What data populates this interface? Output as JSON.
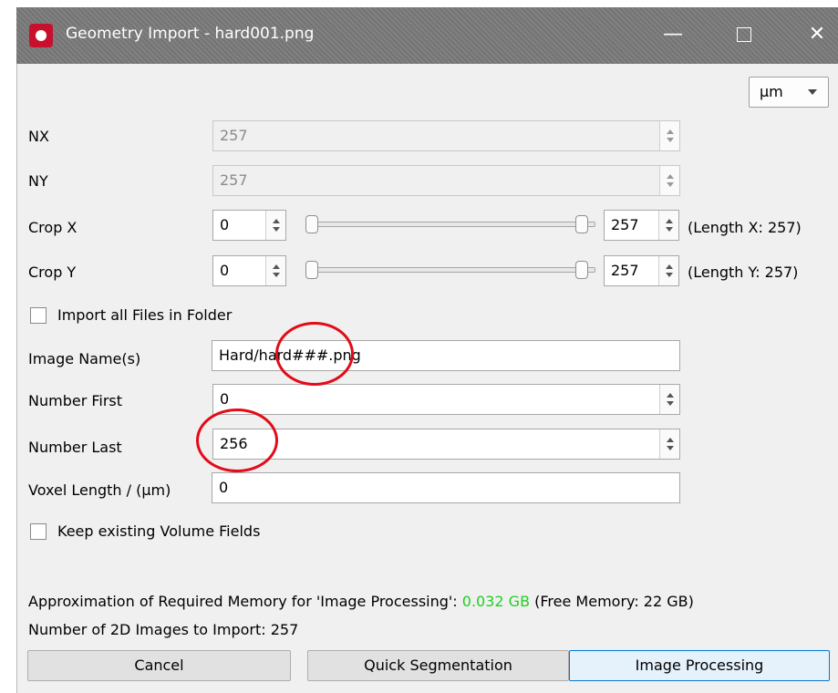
{
  "window": {
    "title": "Geometry Import - hard001.png",
    "app_icon": "app-logo-icon",
    "controls": [
      "minimize-icon",
      "maximize-icon",
      "close-icon"
    ],
    "minimize_glyph": "—",
    "close_glyph": "✕"
  },
  "unit_select": {
    "value": "µm"
  },
  "fields": {
    "nx": {
      "label": "NX",
      "value": "257"
    },
    "ny": {
      "label": "NY",
      "value": "257"
    },
    "crop_x": {
      "label": "Crop X",
      "min": "0",
      "max": "257",
      "length": "(Length X: 257)"
    },
    "crop_y": {
      "label": "Crop Y",
      "min": "0",
      "max": "257",
      "length": "(Length Y: 257)"
    },
    "image_names": {
      "label": "Image Name(s)",
      "value": "Hard/hard###.png"
    },
    "number_first": {
      "label": "Number First",
      "value": "0"
    },
    "number_last": {
      "label": "Number Last",
      "value": "256"
    },
    "voxel_length": {
      "label": "Voxel Length / (µm)",
      "value": "0"
    }
  },
  "checkboxes": {
    "import_all": {
      "label": "Import all Files in Folder",
      "checked": false
    },
    "keep_fields": {
      "label": "Keep existing Volume Fields",
      "checked": false
    }
  },
  "memory": {
    "prefix": "Approximation of Required Memory for 'Image Processing': ",
    "value": "0.032 GB",
    "suffix": " (Free Memory: 22 GB)",
    "value_color": "#1fd11f"
  },
  "images_to_import": "Number of 2D Images to Import: 257",
  "buttons": {
    "cancel": "Cancel",
    "quick_segmentation": "Quick Segmentation",
    "image_processing": "Image Processing"
  },
  "annotation_color": "#e30b17"
}
